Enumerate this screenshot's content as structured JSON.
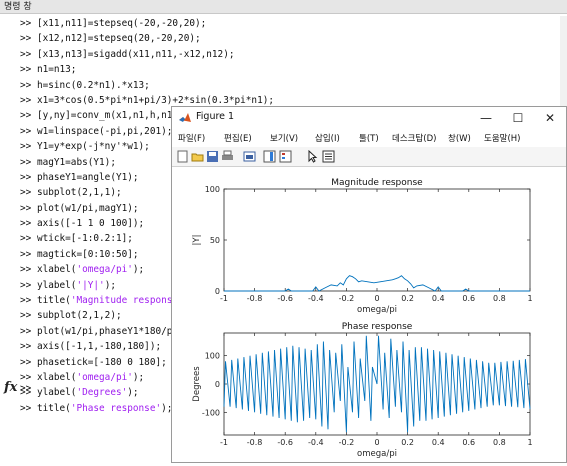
{
  "command_window": {
    "title": "명령 창",
    "lines": [
      {
        "prompt": ">>",
        "parts": [
          {
            "t": " [x11,n11]=stepseq(-20,-20,20);"
          }
        ]
      },
      {
        "prompt": ">>",
        "parts": [
          {
            "t": " [x12,n12]=stepseq(20,-20,20);"
          }
        ]
      },
      {
        "prompt": ">>",
        "parts": [
          {
            "t": " [x13,n13]=sigadd(x11,n11,-x12,n12);"
          }
        ]
      },
      {
        "prompt": ">>",
        "parts": [
          {
            "t": " n1=n13;"
          }
        ]
      },
      {
        "prompt": ">>",
        "parts": [
          {
            "t": " h=sinc(0.2*n1).*x13;"
          }
        ]
      },
      {
        "prompt": ">>",
        "parts": [
          {
            "t": " x1=3*cos(0.5*pi*n1+pi/3)+2*sin(0.3*pi*n1);"
          }
        ]
      },
      {
        "prompt": ">>",
        "parts": [
          {
            "t": " [y,ny]=conv_m(x1,n1,h,n1);"
          }
        ]
      },
      {
        "prompt": ">>",
        "parts": [
          {
            "t": " w1=linspace(-pi,pi,201);"
          }
        ]
      },
      {
        "prompt": ">>",
        "parts": [
          {
            "t": " Y1=y*exp(-j*ny'*w1);"
          }
        ]
      },
      {
        "prompt": ">>",
        "parts": [
          {
            "t": " magY1=abs(Y1);"
          }
        ]
      },
      {
        "prompt": ">>",
        "parts": [
          {
            "t": " phaseY1=angle(Y1);"
          }
        ]
      },
      {
        "prompt": ">>",
        "parts": [
          {
            "t": " subplot(2,1,1);"
          }
        ]
      },
      {
        "prompt": ">>",
        "parts": [
          {
            "t": " plot(w1/pi,magY1);"
          }
        ]
      },
      {
        "prompt": ">>",
        "parts": [
          {
            "t": " axis([-1 1 0 100]);"
          }
        ]
      },
      {
        "prompt": ">>",
        "parts": [
          {
            "t": " wtick=[-1:0.2:1];"
          }
        ]
      },
      {
        "prompt": ">>",
        "parts": [
          {
            "t": " magtick=[0:10:50];"
          }
        ]
      },
      {
        "prompt": ">>",
        "parts": [
          {
            "t": " xlabel("
          },
          {
            "t": "'omega/pi'",
            "s": true
          },
          {
            "t": ");"
          }
        ]
      },
      {
        "prompt": ">>",
        "parts": [
          {
            "t": " ylabel("
          },
          {
            "t": "'|Y|'",
            "s": true
          },
          {
            "t": ");"
          }
        ]
      },
      {
        "prompt": ">>",
        "parts": [
          {
            "t": " title("
          },
          {
            "t": "'Magnitude response'",
            "s": true
          },
          {
            "t": ");"
          }
        ]
      },
      {
        "prompt": ">>",
        "parts": [
          {
            "t": " subplot(2,1,2);"
          }
        ]
      },
      {
        "prompt": ">>",
        "parts": [
          {
            "t": " plot(w1/pi,phaseY1*180/pi);"
          }
        ]
      },
      {
        "prompt": ">>",
        "parts": [
          {
            "t": " axis([-1,1,-180,180]);"
          }
        ]
      },
      {
        "prompt": ">>",
        "parts": [
          {
            "t": " phasetick=[-180 0 180];"
          }
        ]
      },
      {
        "prompt": ">>",
        "parts": [
          {
            "t": " xlabel("
          },
          {
            "t": "'omega/pi'",
            "s": true
          },
          {
            "t": ");"
          }
        ]
      },
      {
        "prompt": ">>",
        "parts": [
          {
            "t": " ylabel("
          },
          {
            "t": "'Degrees'",
            "s": true
          },
          {
            "t": ");"
          }
        ]
      },
      {
        "prompt": ">>",
        "parts": [
          {
            "t": " title("
          },
          {
            "t": "'Phase response'",
            "s": true
          },
          {
            "t": ");"
          }
        ]
      }
    ],
    "fx_symbol": "fx",
    "current_prompt": ">>"
  },
  "figure": {
    "title": "Figure 1",
    "minimize": "—",
    "maximize": "☐",
    "close": "✕",
    "menu": [
      "파일(F)",
      "편집(E)",
      "보기(V)",
      "삽입(I)",
      "툴(T)",
      "데스크탑(D)",
      "창(W)",
      "도움말(H)"
    ],
    "toolbar_icons": [
      "new-figure-icon",
      "open-file-icon",
      "save-icon",
      "print-icon",
      "link-plot-icon",
      "insert-colorbar-icon",
      "insert-legend-icon",
      "pointer-icon",
      "property-inspector-icon"
    ]
  },
  "colors": {
    "line": "#0072bd",
    "string": "#a020f0"
  },
  "chart_data": [
    {
      "type": "line",
      "title": "Magnitude response",
      "xlabel": "omega/pi",
      "ylabel": "|Y|",
      "xlim": [
        -1,
        1
      ],
      "ylim": [
        0,
        100
      ],
      "xticks": [
        -1,
        -0.8,
        -0.6,
        -0.4,
        -0.2,
        0,
        0.2,
        0.4,
        0.6,
        0.8,
        1
      ],
      "xtick_labels": [
        "-1",
        "-0.8",
        "-0.6",
        "-0.4",
        "-0.2",
        "0",
        "0.2",
        "0.4",
        "0.6",
        "0.8",
        "1"
      ],
      "yticks": [
        0,
        50,
        100
      ],
      "ytick_labels": [
        "0",
        "50",
        "100"
      ],
      "series": [
        {
          "x": [
            -1,
            -0.6,
            -0.58,
            -0.56,
            -0.5,
            -0.42,
            -0.4,
            -0.38,
            -0.34,
            -0.3,
            -0.26,
            -0.24,
            -0.22,
            -0.2,
            -0.18,
            -0.16,
            -0.14,
            -0.12,
            -0.1,
            -0.06,
            -0.02,
            0.02,
            0.06,
            0.1,
            0.12,
            0.14,
            0.16,
            0.18,
            0.2,
            0.22,
            0.24,
            0.26,
            0.3,
            0.34,
            0.38,
            0.4,
            0.42,
            0.5,
            0.56,
            0.58,
            0.6,
            1
          ],
          "y": [
            0,
            0,
            2,
            0,
            0,
            0,
            4,
            0,
            3,
            6,
            5,
            8,
            6,
            12,
            15,
            14,
            12,
            9,
            10,
            9,
            8,
            9,
            10,
            11,
            12,
            13,
            15,
            12,
            10,
            7,
            3,
            5,
            6,
            3,
            0,
            4,
            0,
            0,
            0,
            2,
            0,
            0
          ]
        }
      ]
    },
    {
      "type": "line",
      "title": "Phase response",
      "xlabel": "omega/pi",
      "ylabel": "Degrees",
      "xlim": [
        -1,
        1
      ],
      "ylim": [
        -180,
        180
      ],
      "xticks": [
        -1,
        -0.8,
        -0.6,
        -0.4,
        -0.2,
        0,
        0.2,
        0.4,
        0.6,
        0.8,
        1
      ],
      "xtick_labels": [
        "-1",
        "-0.8",
        "-0.6",
        "-0.4",
        "-0.2",
        "0",
        "0.2",
        "0.4",
        "0.6",
        "0.8",
        "1"
      ],
      "yticks": [
        -100,
        0,
        100
      ],
      "ytick_labels": [
        "-100",
        "0",
        "100"
      ],
      "series": [
        {
          "x": [
            -1,
            -0.99,
            -0.96,
            -0.95,
            -0.92,
            -0.91,
            -0.88,
            -0.87,
            -0.84,
            -0.83,
            -0.8,
            -0.79,
            -0.76,
            -0.75,
            -0.72,
            -0.71,
            -0.68,
            -0.67,
            -0.64,
            -0.63,
            -0.6,
            -0.59,
            -0.56,
            -0.55,
            -0.52,
            -0.51,
            -0.48,
            -0.47,
            -0.44,
            -0.43,
            -0.4,
            -0.39,
            -0.36,
            -0.35,
            -0.32,
            -0.31,
            -0.28,
            -0.27,
            -0.24,
            -0.23,
            -0.2,
            -0.19,
            -0.16,
            -0.15,
            -0.12,
            -0.11,
            -0.08,
            -0.07,
            -0.04,
            -0.03,
            0,
            0.01,
            0.04,
            0.05,
            0.08,
            0.09,
            0.12,
            0.13,
            0.16,
            0.17,
            0.2,
            0.21,
            0.24,
            0.25,
            0.28,
            0.29,
            0.32,
            0.33,
            0.36,
            0.37,
            0.4,
            0.41,
            0.44,
            0.45,
            0.48,
            0.49,
            0.52,
            0.53,
            0.56,
            0.57,
            0.6,
            0.61,
            0.64,
            0.65,
            0.68,
            0.69,
            0.72,
            0.73,
            0.76,
            0.77,
            0.8,
            0.81,
            0.84,
            0.85,
            0.88,
            0.89,
            0.92,
            0.93,
            0.96,
            0.97,
            1
          ],
          "y": [
            -80,
            80,
            -80,
            85,
            -85,
            90,
            -90,
            95,
            -95,
            100,
            -100,
            105,
            -105,
            110,
            -110,
            115,
            -115,
            120,
            -120,
            125,
            -125,
            130,
            -130,
            135,
            -135,
            130,
            -130,
            125,
            -120,
            120,
            -125,
            140,
            -150,
            150,
            -160,
            120,
            -100,
            110,
            -60,
            140,
            -170,
            60,
            -100,
            150,
            -120,
            90,
            -60,
            170,
            -130,
            60,
            0,
            170,
            -90,
            110,
            -120,
            160,
            -80,
            120,
            -100,
            150,
            -170,
            120,
            -150,
            130,
            -130,
            130,
            -130,
            125,
            -125,
            120,
            -120,
            115,
            -115,
            110,
            -110,
            105,
            -105,
            100,
            -100,
            95,
            -95,
            90,
            -90,
            85,
            -85,
            80,
            -80,
            75,
            -75,
            75,
            -75,
            78,
            -78,
            80,
            -80,
            82,
            -82,
            85,
            -85,
            88,
            -88
          ]
        }
      ]
    }
  ]
}
